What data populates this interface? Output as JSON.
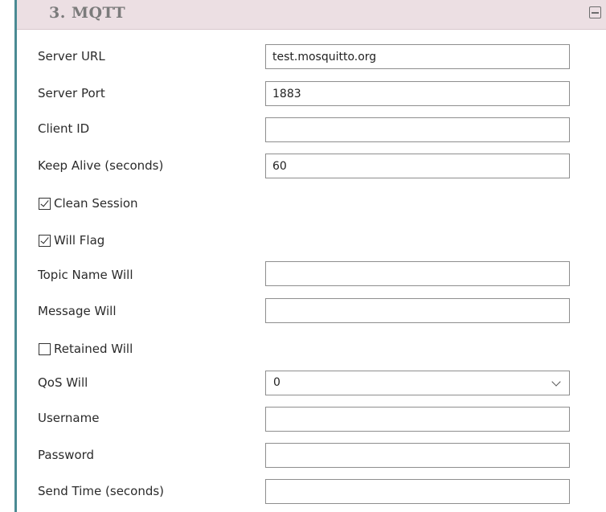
{
  "section": {
    "title": "3. MQTT",
    "collapse_icon": "minus-box-icon"
  },
  "fields": {
    "server_url": {
      "label": "Server URL",
      "value": "test.mosquitto.org"
    },
    "server_port": {
      "label": "Server Port",
      "value": "1883"
    },
    "client_id": {
      "label": "Client ID",
      "value": ""
    },
    "keep_alive": {
      "label": "Keep Alive (seconds)",
      "value": "60"
    },
    "clean_session": {
      "label": "Clean Session",
      "checked": true
    },
    "will_flag": {
      "label": "Will Flag",
      "checked": true
    },
    "topic_name_will": {
      "label": "Topic Name Will",
      "value": ""
    },
    "message_will": {
      "label": "Message Will",
      "value": ""
    },
    "retained_will": {
      "label": "Retained Will",
      "checked": false
    },
    "qos_will": {
      "label": "QoS Will",
      "value": "0"
    },
    "username": {
      "label": "Username",
      "value": ""
    },
    "password": {
      "label": "Password",
      "value": ""
    },
    "send_time": {
      "label": "Send Time (seconds)",
      "value": ""
    }
  },
  "colors": {
    "header_bg": "#ecdfe3",
    "accent_border": "#4a8a93"
  }
}
